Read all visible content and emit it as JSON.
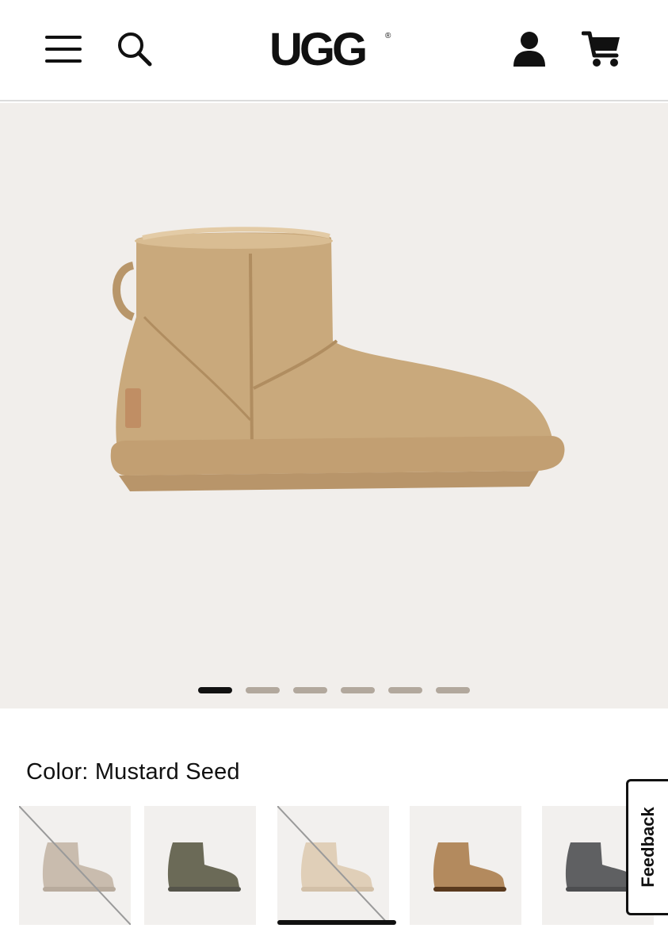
{
  "header": {
    "logo_text": "UGG",
    "icons": [
      "menu-icon",
      "search-icon",
      "account-icon",
      "cart-icon"
    ]
  },
  "gallery": {
    "slide_count": 6,
    "active_slide": 1,
    "background": "#f1eeeb"
  },
  "color_section": {
    "label": "Color: Mustard Seed",
    "swatches": [
      {
        "color": "#c9bcae",
        "unavailable": true,
        "selected": false
      },
      {
        "color": "#6b6a57",
        "unavailable": false,
        "selected": false
      },
      {
        "color": "#e0cfb8",
        "unavailable": true,
        "selected": true
      },
      {
        "color": "#b38a5e",
        "unavailable": false,
        "selected": false
      },
      {
        "color": "#5f6062",
        "unavailable": false,
        "selected": false
      }
    ]
  },
  "feedback": {
    "label": "Feedback"
  },
  "colors": {
    "boot_main": "#c9a97c",
    "dot_inactive": "#b2a89d",
    "dot_active": "#111111"
  }
}
